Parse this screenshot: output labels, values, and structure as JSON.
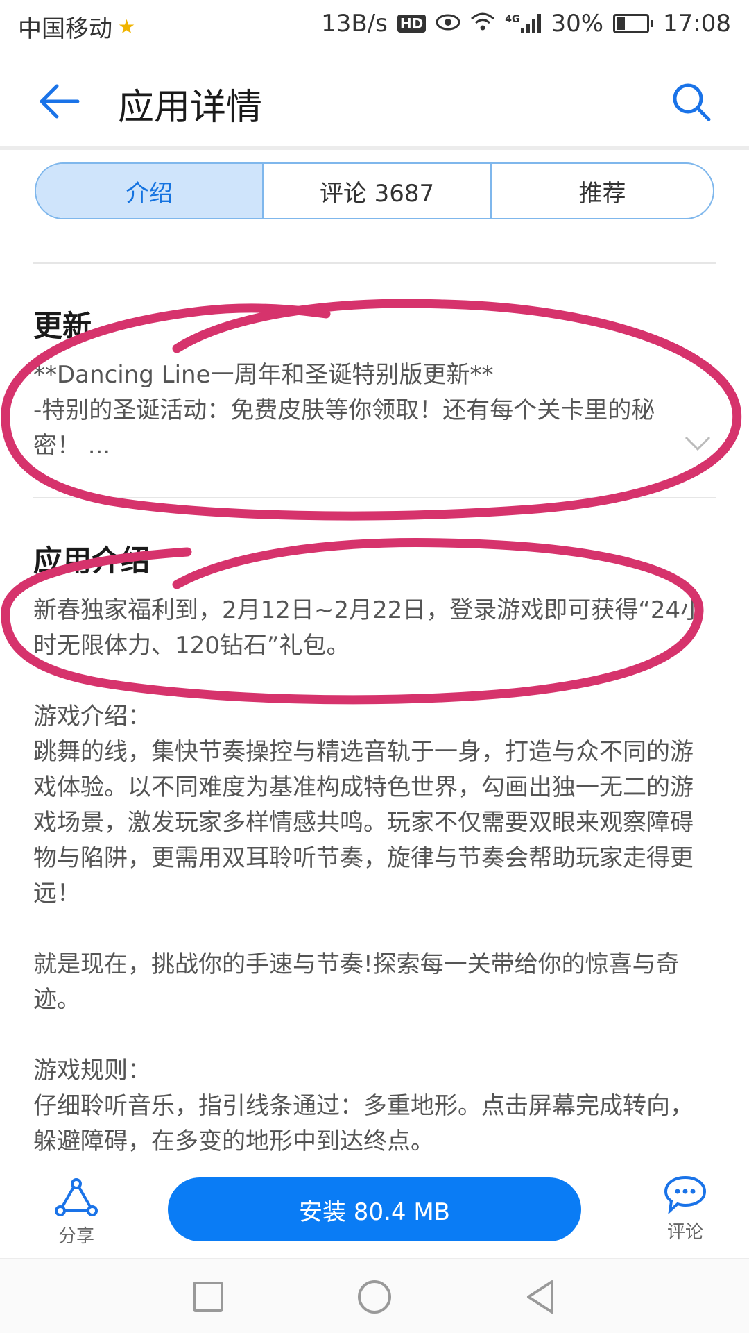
{
  "status_bar": {
    "carrier": "中国移动",
    "net_speed": "13B/s",
    "hd": "HD",
    "network": "4G",
    "battery": "30%",
    "time": "17:08"
  },
  "header": {
    "title": "应用详情"
  },
  "tabs": [
    {
      "label": "介绍",
      "active": true
    },
    {
      "label": "评论 3687",
      "active": false
    },
    {
      "label": "推荐",
      "active": false
    }
  ],
  "update": {
    "title": "更新",
    "lines": [
      "**Dancing Line一周年和圣诞特别版更新**",
      "-特别的圣诞活动：免费皮肤等你领取！还有每个关卡里的秘密！ ..."
    ]
  },
  "intro": {
    "title": "应用介绍",
    "paragraphs": [
      "新春独家福利到，2月12日~2月22日，登录游戏即可获得“24小时无限体力、120钻石”礼包。",
      "游戏介绍：\n跳舞的线，集快节奏操控与精选音轨于一身，打造与众不同的游戏体验。以不同难度为基准构成特色世界，勾画出独一无二的游戏场景，激发玩家多样情感共鸣。玩家不仅需要双眼来观察障碍物与陷阱，更需用双耳聆听节奏，旋律与节奏会帮助玩家走得更远！",
      "就是现在，挑战你的手速与节奏!探索每一关带给你的惊喜与奇迹。",
      "游戏规则：\n仔细聆听音乐，指引线条通过：多重地形。点击屏幕完成转向，躲避障碍，在多变的地形中到达终点。"
    ]
  },
  "actions": {
    "share_label": "分享",
    "install_label": "安装 80.4 MB",
    "comment_label": "评论"
  },
  "colors": {
    "accent": "#0a7cf5",
    "annotation": "#d6336c"
  }
}
